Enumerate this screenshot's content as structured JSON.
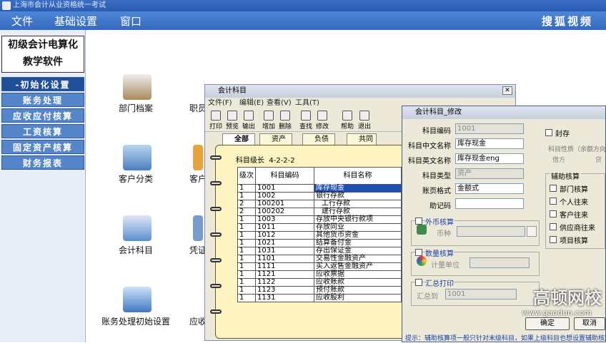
{
  "app": {
    "title": "上海市会计从业资格统一考试"
  },
  "menu": [
    "文件",
    "基础设置",
    "窗口"
  ],
  "watermark": {
    "sohu": "搜狐视频",
    "gaodun": "高顿网校",
    "gaodun_url": "www.gaodun.com"
  },
  "logo": {
    "line1": "初级会计电算化",
    "line2": "教学软件"
  },
  "nav": [
    "-初始化设置",
    "账务处理",
    "应收应付核算",
    "工资核算",
    "固定资产核算",
    "财务报表"
  ],
  "desktop": {
    "icons": [
      "部门档案",
      "职员",
      "客户分类",
      "客户",
      "会计科目",
      "凭证",
      "账务处理初始设置",
      "应收"
    ]
  },
  "accounts_window": {
    "title": "会计科目",
    "menu": [
      "文件(F)",
      "编辑(E)",
      "查看(V)",
      "工具(T)"
    ],
    "toolbar": [
      "打印",
      "预览",
      "输出",
      "增加",
      "删除",
      "查找",
      "修改",
      "帮助",
      "退出"
    ],
    "tabs": [
      "全部",
      "资产",
      "负债",
      "共同"
    ],
    "level_label": "科目级长",
    "level_value": "4-2-2-2",
    "columns": [
      "级次",
      "科目编码",
      "科目名称"
    ],
    "rows": [
      {
        "level": "1",
        "code": "1001",
        "name": "库存现金"
      },
      {
        "level": "1",
        "code": "1002",
        "name": "银行存款"
      },
      {
        "level": "2",
        "code": "100201",
        "name": "工行存款"
      },
      {
        "level": "2",
        "code": "100202",
        "name": "建行存款"
      },
      {
        "level": "1",
        "code": "1003",
        "name": "存放中央银行款项"
      },
      {
        "level": "1",
        "code": "1011",
        "name": "存放同业"
      },
      {
        "level": "1",
        "code": "1012",
        "name": "其他货币资金"
      },
      {
        "level": "1",
        "code": "1021",
        "name": "结算备付金"
      },
      {
        "level": "1",
        "code": "1031",
        "name": "存出保证金"
      },
      {
        "level": "1",
        "code": "1101",
        "name": "交易性金融资产"
      },
      {
        "level": "1",
        "code": "1111",
        "name": "买入返售金融资产"
      },
      {
        "level": "1",
        "code": "1121",
        "name": "应收票据"
      },
      {
        "level": "1",
        "code": "1122",
        "name": "应收账款"
      },
      {
        "level": "1",
        "code": "1123",
        "name": "预付账款"
      },
      {
        "level": "1",
        "code": "1131",
        "name": "应收股利"
      }
    ]
  },
  "edit_window": {
    "title": "会计科目_修改",
    "code_label": "科目编码",
    "code_value": "1001",
    "cn_label": "科目中文名称",
    "cn_value": "库存现金",
    "en_label": "科目英文名称",
    "en_value": "库存现金eng",
    "type_label": "科目类型",
    "type_value": "资产",
    "format_label": "账页格式",
    "format_value": "金额式",
    "mnemonic_label": "助记码",
    "sealed_label": "封存",
    "nature_label": "科目性质（余额方向）",
    "debit_label": "借方",
    "credit_label": "贷",
    "aux_label": "辅助核算",
    "aux_items": [
      "部门核算",
      "个人往来",
      "客户往来",
      "供应商往来",
      "项目核算"
    ],
    "fx_label": "外币核算",
    "currency_label": "币种",
    "qty_label": "数量核算",
    "unit_label": "计量单位",
    "summary_label": "汇总打印",
    "summary_to_label": "汇总到",
    "summary_value": "1001",
    "ok": "确定",
    "cancel": "取消",
    "hint": "提示：辅助核算项一般只针对末级科目，如果上级科目也想设置辅助核算"
  },
  "colors": {
    "accent": "#3569bd",
    "selection": "#1c4fb8",
    "notebook": "#fdf4c2"
  }
}
